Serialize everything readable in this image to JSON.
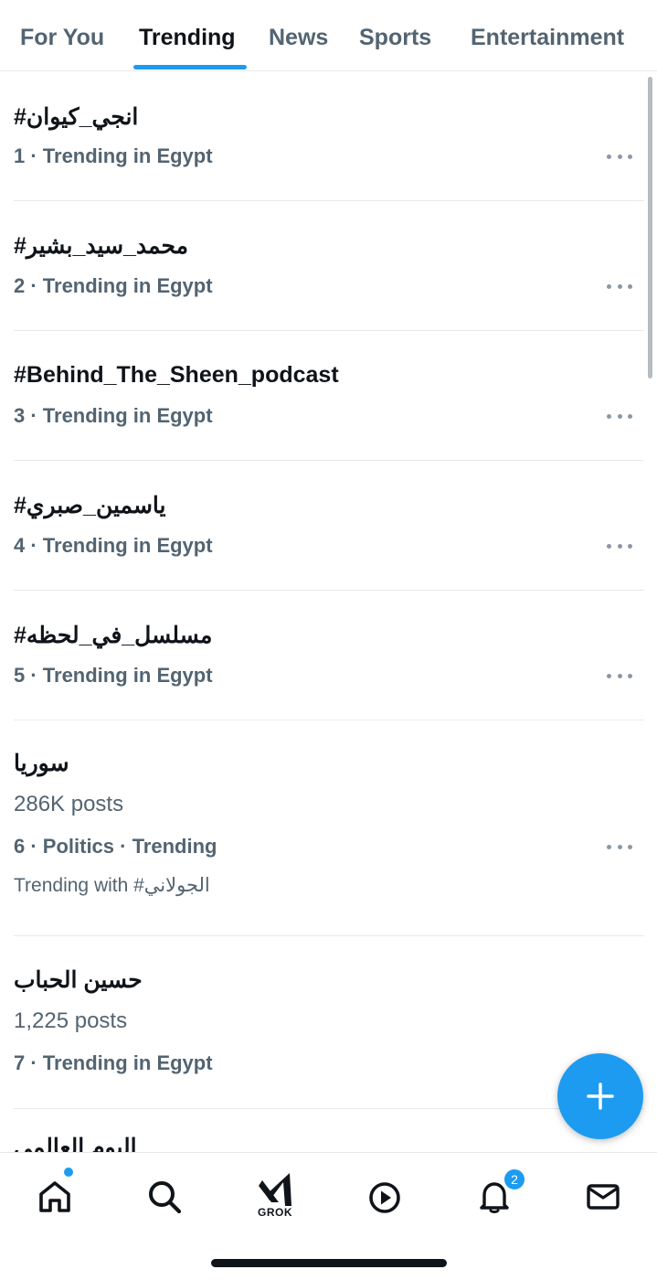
{
  "tabs": [
    {
      "label": "For You",
      "active": false
    },
    {
      "label": "Trending",
      "active": true
    },
    {
      "label": "News",
      "active": false
    },
    {
      "label": "Sports",
      "active": false
    },
    {
      "label": "Entertainment",
      "active": false
    }
  ],
  "trends": [
    {
      "title": "#انجي_كيوان",
      "meta": "1 · Trending in Egypt"
    },
    {
      "title": "#محمد_سيد_بشير",
      "meta": "2 · Trending in Egypt"
    },
    {
      "title": "#Behind_The_Sheen_podcast",
      "meta": "3 · Trending in Egypt"
    },
    {
      "title": "#ياسمين_صبري",
      "meta": "4 · Trending in Egypt"
    },
    {
      "title": "#مسلسل_في_لحظه",
      "meta": "5 · Trending in Egypt"
    },
    {
      "title": "سوريا",
      "posts": "286K posts",
      "meta": "6 · Politics · Trending",
      "trending_with": "Trending with #الجولاني"
    },
    {
      "title": "حسين الحباب",
      "posts": "1,225 posts",
      "meta": "7 · Trending in Egypt"
    },
    {
      "title": "اليوم العالمي"
    }
  ],
  "fab": {
    "icon": "plus-icon"
  },
  "bottom_nav": {
    "items": [
      {
        "name": "home",
        "icon": "home-icon"
      },
      {
        "name": "search",
        "icon": "search-icon"
      },
      {
        "name": "grok",
        "icon": "grok-icon",
        "label": "GROK"
      },
      {
        "name": "video",
        "icon": "play-icon"
      },
      {
        "name": "notifications",
        "icon": "bell-icon",
        "badge": "2"
      },
      {
        "name": "messages",
        "icon": "mail-icon"
      }
    ]
  },
  "colors": {
    "accent": "#1d9bf0",
    "text_primary": "#0f1419",
    "text_secondary": "#536471",
    "divider": "#e7e9ea"
  }
}
